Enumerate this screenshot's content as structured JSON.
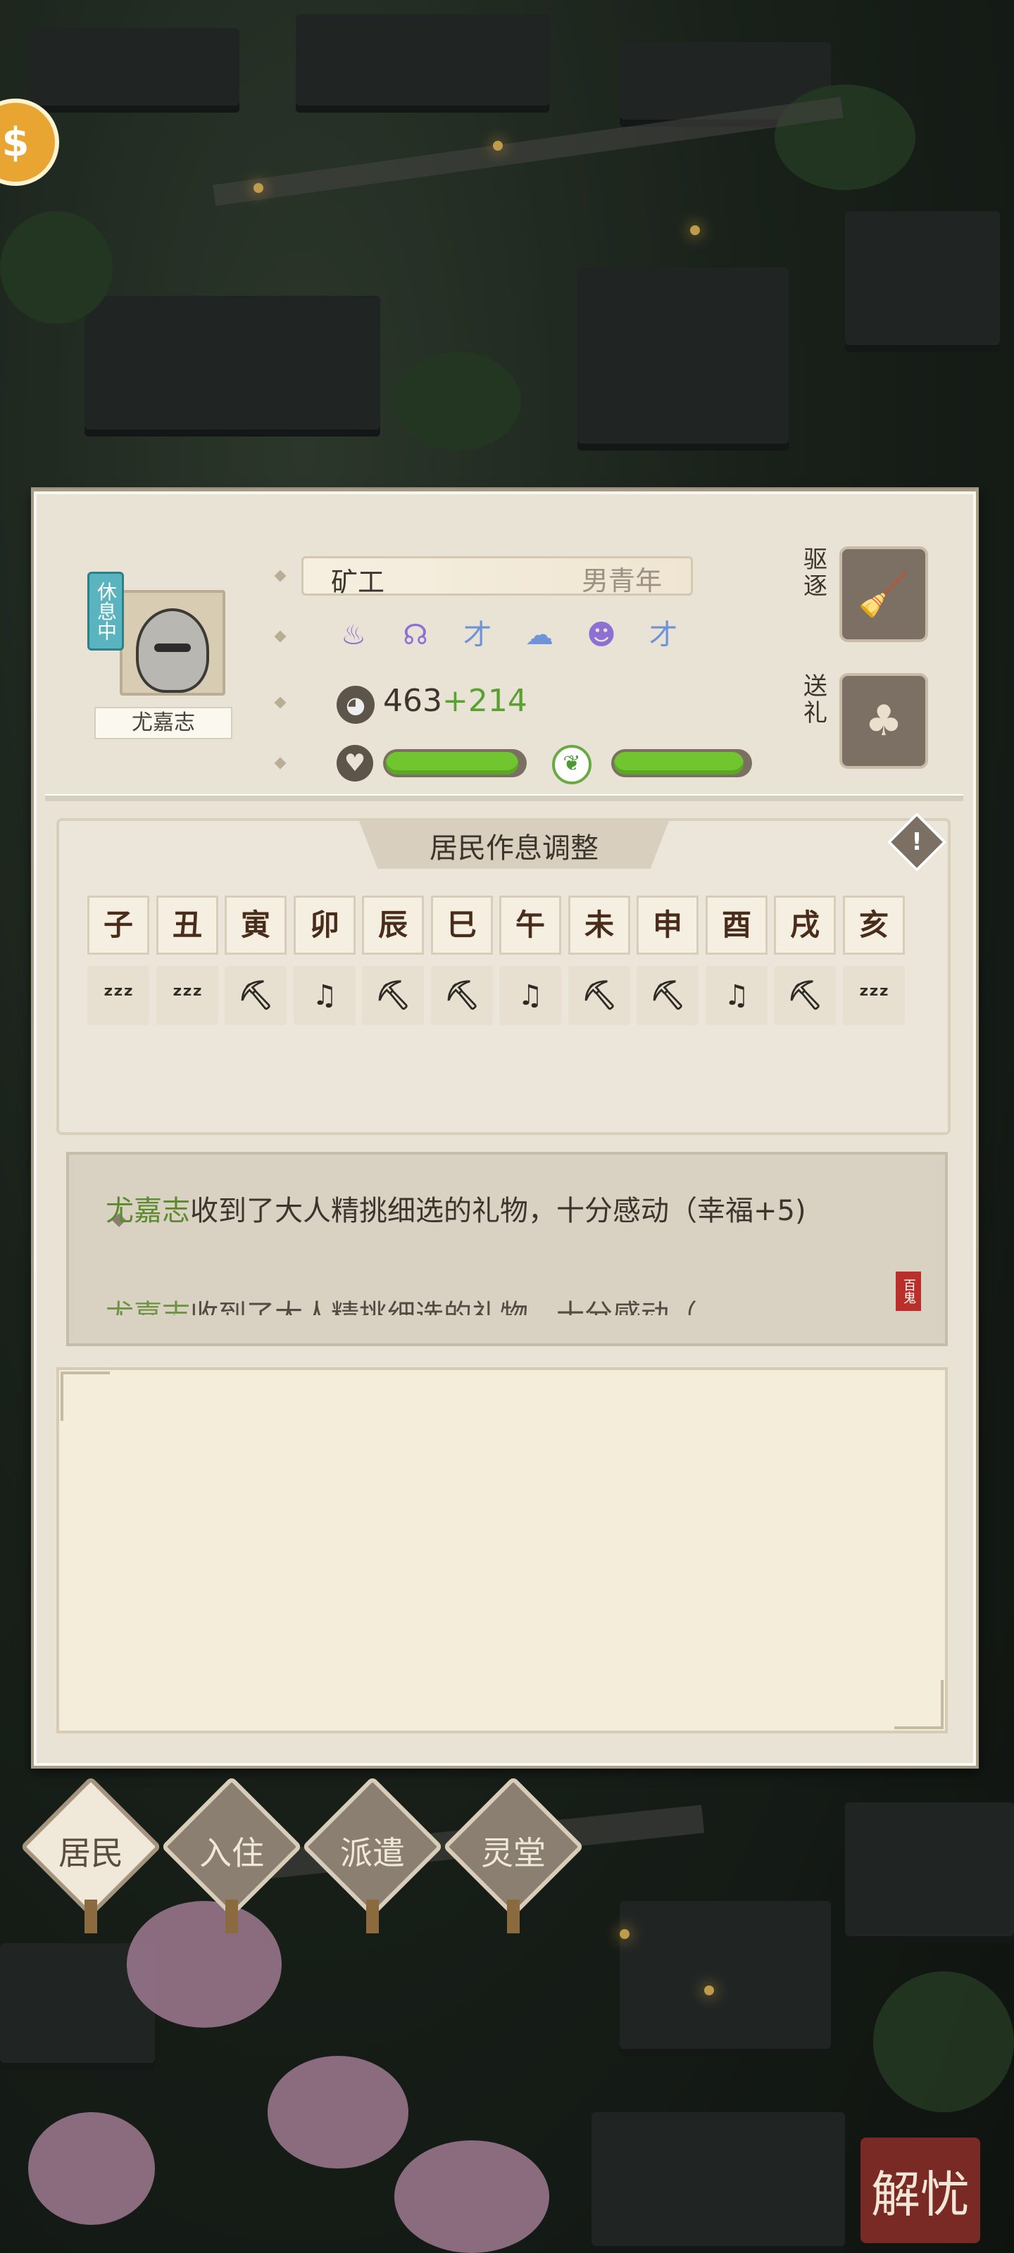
{
  "resident": {
    "name": "尤嘉志",
    "status_tag": "休息中",
    "job": "矿工",
    "gender_age": "男青年",
    "traits": [
      {
        "icon": "purple-flame-icon",
        "glyph": "♨",
        "color": "#8e6fd3"
      },
      {
        "icon": "purple-hood-icon",
        "glyph": "☊",
        "color": "#8e6fd3"
      },
      {
        "icon": "blue-brush-icon",
        "glyph": "才",
        "color": "#6e93d8"
      },
      {
        "icon": "blue-fish-icon",
        "glyph": "☁",
        "color": "#6e93d8"
      },
      {
        "icon": "purple-pig-icon",
        "glyph": "☻",
        "color": "#8e6fd3"
      },
      {
        "icon": "blue-brush-icon",
        "glyph": "才",
        "color": "#6e93d8"
      }
    ],
    "ability_base": "463",
    "ability_bonus": "+214",
    "happiness_fraction": 0.96,
    "energy_fraction": 0.96
  },
  "actions": {
    "expel_label": "驱逐",
    "gift_label": "送礼"
  },
  "schedule": {
    "title": "居民作息调整",
    "hours": [
      "子",
      "丑",
      "寅",
      "卯",
      "辰",
      "巳",
      "午",
      "未",
      "申",
      "酉",
      "戌",
      "亥"
    ],
    "activities": [
      {
        "type": "sleep",
        "icon": "sleep-icon",
        "glyph": "ᶻᶻᶻ"
      },
      {
        "type": "sleep",
        "icon": "sleep-icon",
        "glyph": "ᶻᶻᶻ"
      },
      {
        "type": "work",
        "icon": "pickaxe-icon",
        "glyph": "⛏"
      },
      {
        "type": "rest",
        "icon": "music-rest-icon",
        "glyph": "♫"
      },
      {
        "type": "work",
        "icon": "pickaxe-icon",
        "glyph": "⛏"
      },
      {
        "type": "work",
        "icon": "pickaxe-icon",
        "glyph": "⛏"
      },
      {
        "type": "rest",
        "icon": "music-rest-icon",
        "glyph": "♫"
      },
      {
        "type": "work",
        "icon": "pickaxe-icon",
        "glyph": "⛏"
      },
      {
        "type": "work",
        "icon": "pickaxe-icon",
        "glyph": "⛏"
      },
      {
        "type": "rest",
        "icon": "music-rest-icon",
        "glyph": "♫"
      },
      {
        "type": "work",
        "icon": "pickaxe-icon",
        "glyph": "⛏"
      },
      {
        "type": "sleep",
        "icon": "sleep-icon",
        "glyph": "ᶻᶻᶻ"
      }
    ]
  },
  "log": {
    "entries": [
      {
        "name": "尤嘉志",
        "text": "收到了大人精挑细选的礼物，十分感动（幸福+5)"
      },
      {
        "name": "尤嘉志",
        "text": "收到了大人精挑细选的礼物，十分感动（"
      }
    ],
    "seal_text": "百鬼"
  },
  "tabs": [
    {
      "label": "居民",
      "active": true
    },
    {
      "label": "入住",
      "active": false
    },
    {
      "label": "派遣",
      "active": false
    },
    {
      "label": "灵堂",
      "active": false
    }
  ],
  "corner_button": "解忧",
  "colors": {
    "panel_bg": "#e9e3d6",
    "bar_fill": "#71c62f",
    "bonus_green": "#5aa032",
    "name_green": "#5c8a2e",
    "status_teal": "#59b4bf"
  }
}
